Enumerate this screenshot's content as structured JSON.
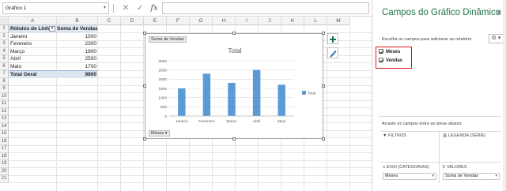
{
  "formula_bar": {
    "name_box": "Gráfico 1",
    "cancel_symbol": "✕",
    "enter_symbol": "✓",
    "fx_label": "fx",
    "formula": ""
  },
  "grid": {
    "columns": [
      "A",
      "B",
      "C",
      "D",
      "E",
      "F",
      "G",
      "H",
      "I",
      "J",
      "K",
      "L",
      "M"
    ],
    "rows": [
      "1",
      "2",
      "3",
      "4",
      "5",
      "6",
      "7",
      "8",
      "9",
      "10",
      "11",
      "12",
      "13",
      "14",
      "15",
      "16",
      "17",
      "18",
      "19",
      "20",
      "21"
    ]
  },
  "pivot_table": {
    "header_row_labels": "Rótulos de Linha",
    "header_values": "Soma de Vendas",
    "rows": [
      {
        "label": "Janeiro",
        "value": "1500"
      },
      {
        "label": "Fevereiro",
        "value": "2300"
      },
      {
        "label": "Março",
        "value": "1800"
      },
      {
        "label": "Abril",
        "value": "2500"
      },
      {
        "label": "Maio",
        "value": "1700"
      }
    ],
    "total_label": "Total Geral",
    "total_value": "9800"
  },
  "chart": {
    "values_field_button": "Soma de Vendas",
    "axis_field_button": "Meses",
    "side_buttons": [
      "plus-icon",
      "brush-icon"
    ]
  },
  "chart_data": {
    "type": "bar",
    "title": "Total",
    "categories": [
      "Janeiro",
      "Fevereiro",
      "Março",
      "Abril",
      "Maio"
    ],
    "series": [
      {
        "name": "Total",
        "values": [
          1500,
          2300,
          1800,
          2500,
          1700
        ]
      }
    ],
    "ylim": [
      0,
      3000
    ],
    "yticks": [
      "0",
      "500",
      "1000",
      "1500",
      "2000",
      "2500",
      "3000"
    ],
    "bar_color": "#5b9bd5",
    "legend_position": "right",
    "grid": true
  },
  "pane": {
    "title": "Campos do Gráfico Dinâmico",
    "close_symbol": "✕",
    "subtitle": "Escolha os campos para adicionar ao relatório:",
    "gear_symbol": "⚙ ▾",
    "fields": [
      {
        "label": "Meses",
        "checked": true
      },
      {
        "label": "Vendas",
        "checked": true
      }
    ],
    "drag_text": "Arraste os campos entre as áreas abaixo:",
    "areas": {
      "filters": "FILTROS",
      "legend": "LEGENDA (SÉRIE)",
      "axis": "EIXO (CATEGORIAS)",
      "values": "VALORES",
      "axis_field": "Meses",
      "values_field": "Soma de Vendas"
    },
    "accent_color": "#217346",
    "highlight_color": "#e2141c"
  }
}
